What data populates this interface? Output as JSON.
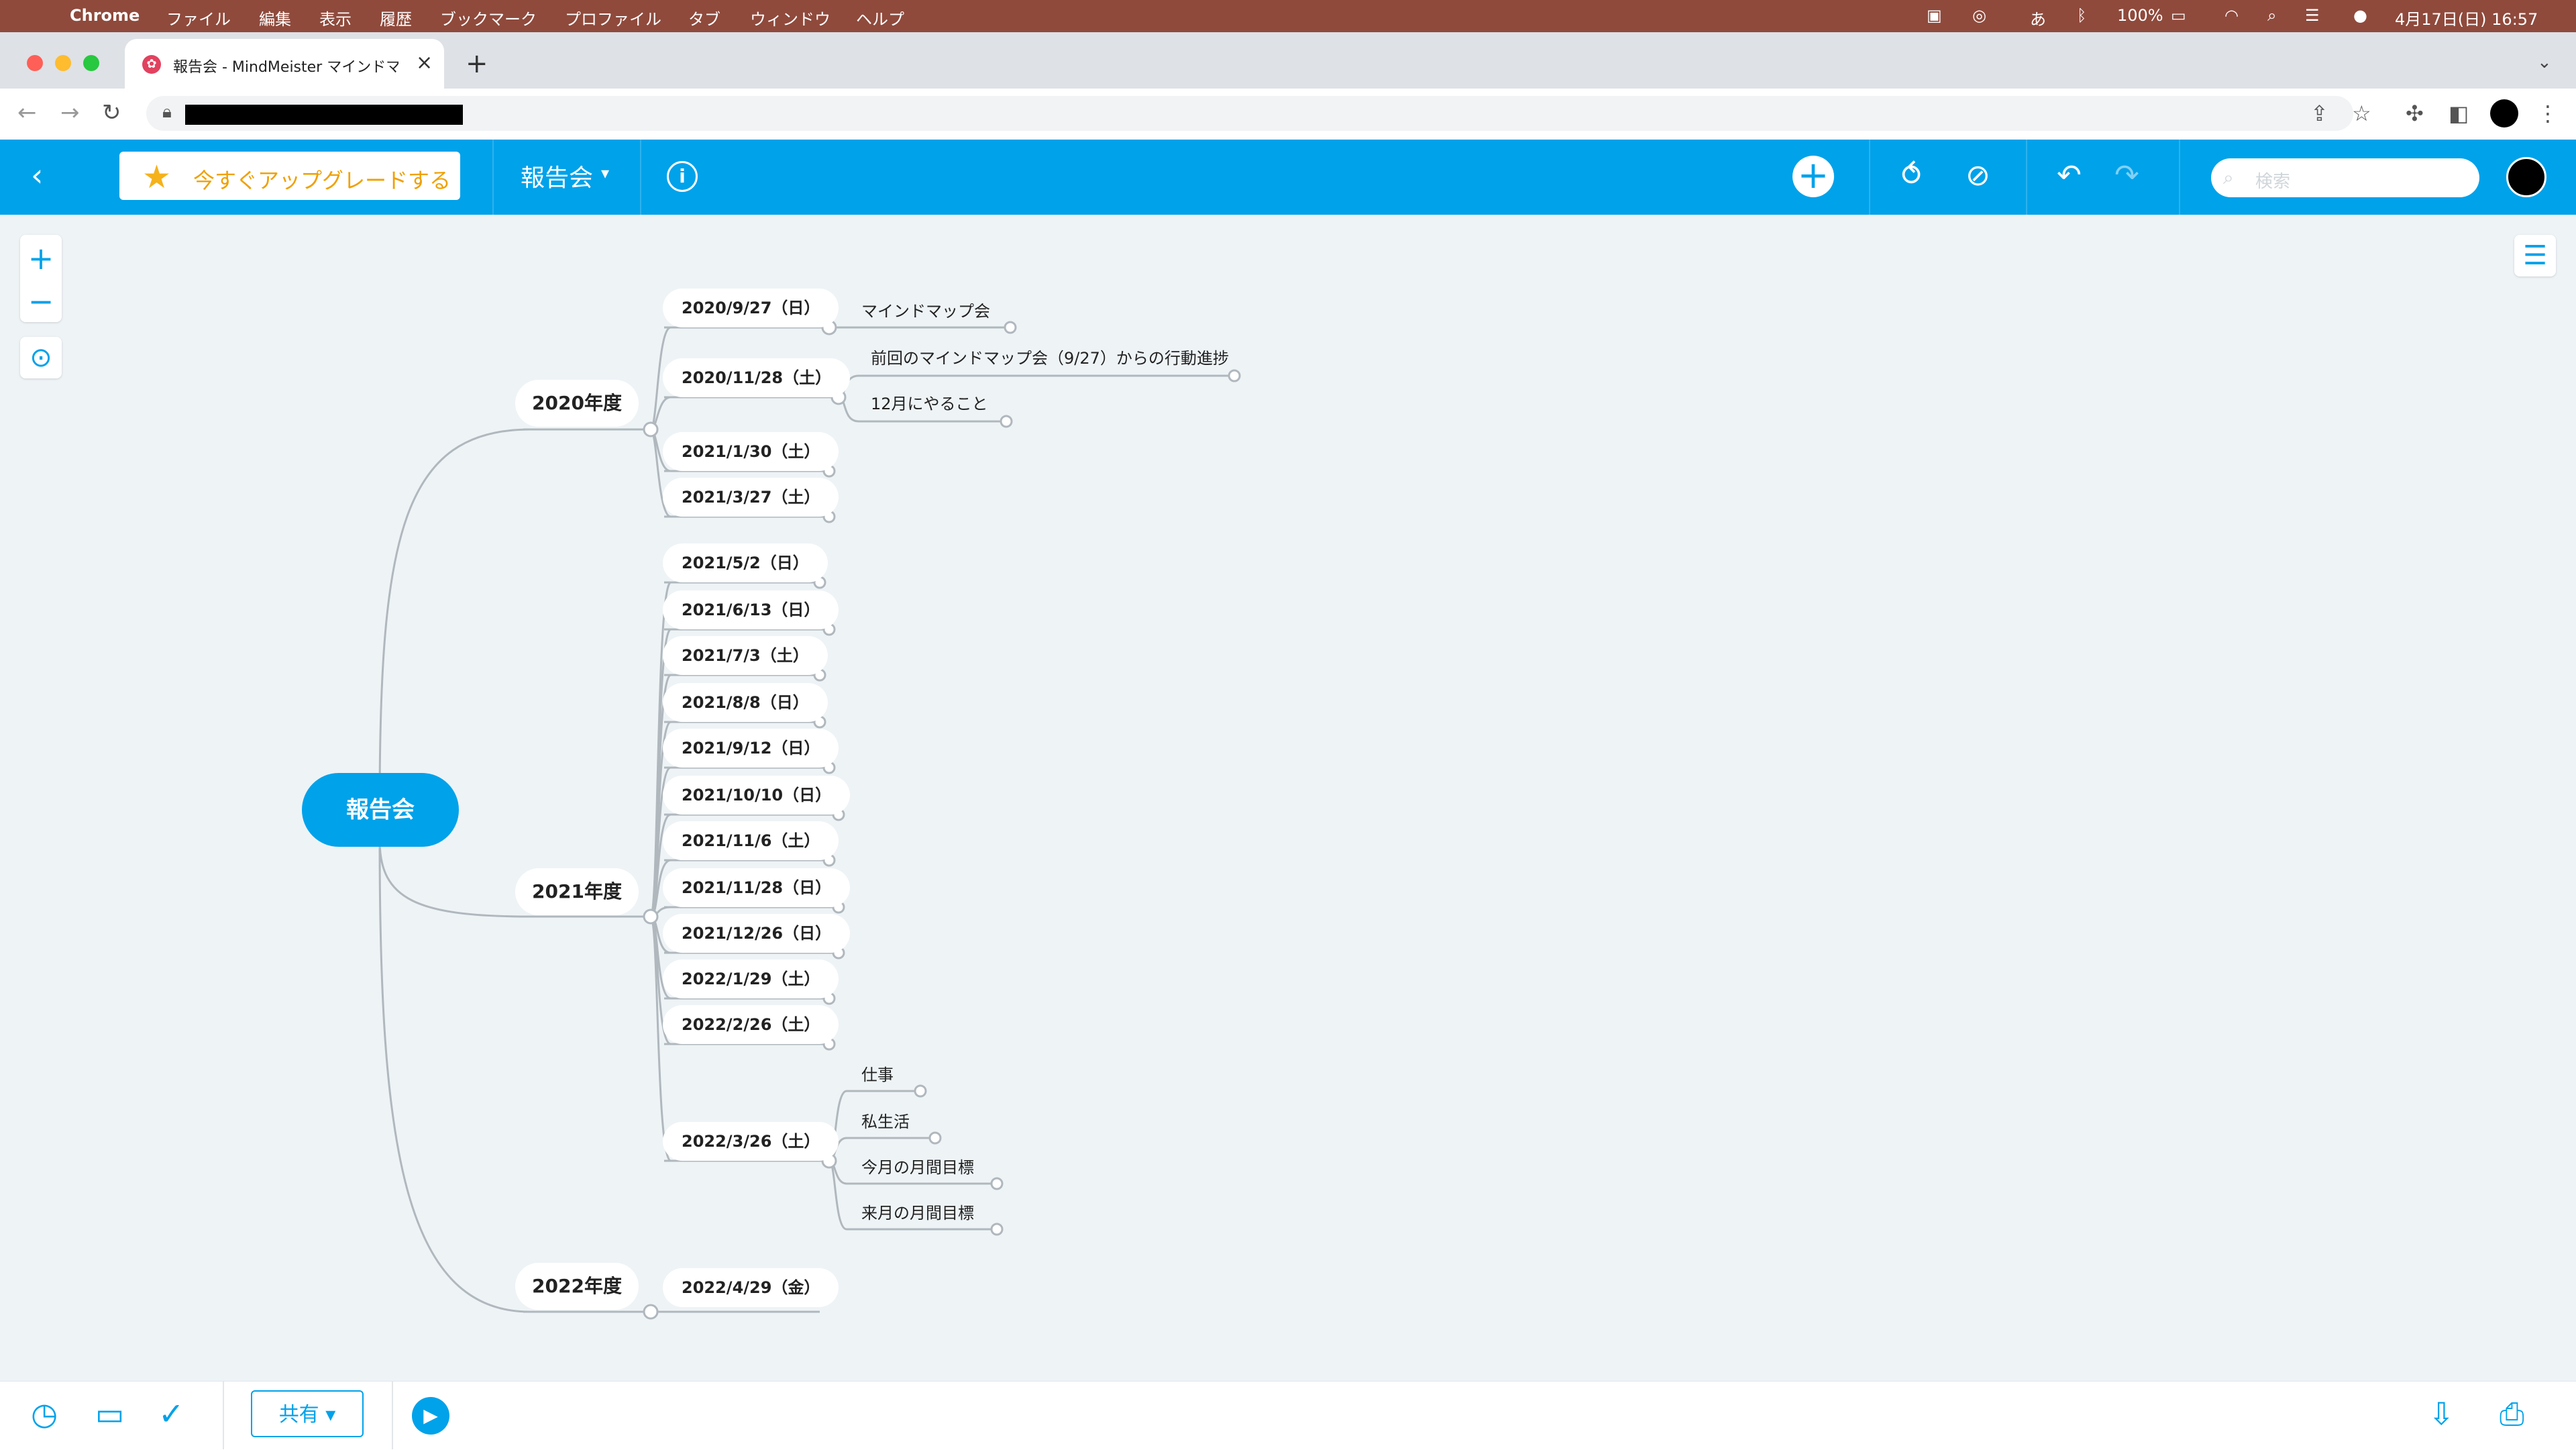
{
  "mac_menu": {
    "apple": "",
    "app": "Chrome",
    "items": [
      "ファイル",
      "編集",
      "表示",
      "履歴",
      "ブックマーク",
      "プロファイル",
      "タブ",
      "ウィンドウ",
      "ヘルプ"
    ],
    "battery": "100%",
    "datetime": "4月17日(日) 16:57",
    "ime": "あ"
  },
  "browser": {
    "tab_title": "報告会 - MindMeister マインドマ",
    "favicon": "✿",
    "tab_close": "×",
    "new_tab": "+"
  },
  "app_header": {
    "upgrade_label": "今すぐアップグレードする",
    "map_title": "報告会",
    "search_placeholder": "検索"
  },
  "mindmap": {
    "root": "報告会",
    "branches": [
      {
        "label": "2020年度",
        "children": [
          {
            "label": "2020/9/27（日）",
            "children": [
              "マインドマップ会"
            ]
          },
          {
            "label": "2020/11/28（土）",
            "children": [
              "前回のマインドマップ会（9/27）からの行動進捗",
              "12月にやること"
            ]
          },
          {
            "label": "2021/1/30（土）",
            "children": []
          },
          {
            "label": "2021/3/27（土）",
            "children": []
          }
        ]
      },
      {
        "label": "2021年度",
        "children": [
          {
            "label": "2021/5/2（日）",
            "children": []
          },
          {
            "label": "2021/6/13（日）",
            "children": []
          },
          {
            "label": "2021/7/3（土）",
            "children": []
          },
          {
            "label": "2021/8/8（日）",
            "children": []
          },
          {
            "label": "2021/9/12（日）",
            "children": []
          },
          {
            "label": "2021/10/10（日）",
            "children": []
          },
          {
            "label": "2021/11/6（土）",
            "children": []
          },
          {
            "label": "2021/11/28（日）",
            "children": []
          },
          {
            "label": "2021/12/26（日）",
            "children": []
          },
          {
            "label": "2022/1/29（土）",
            "children": []
          },
          {
            "label": "2022/2/26（土）",
            "children": []
          },
          {
            "label": "2022/3/26（土）",
            "children": [
              "仕事",
              "私生活",
              "今月の月間目標",
              "来月の月間目標"
            ]
          }
        ]
      },
      {
        "label": "2022年度",
        "children": [
          {
            "label": "2022/4/29（金）",
            "children": []
          }
        ]
      }
    ]
  },
  "bottom_bar": {
    "share_label": "共有 ▾"
  },
  "colors": {
    "accent": "#00a2ea",
    "canvas": "#eef3f6",
    "upgrade_text": "#f0a000",
    "menubar": "#8f4a3c"
  }
}
